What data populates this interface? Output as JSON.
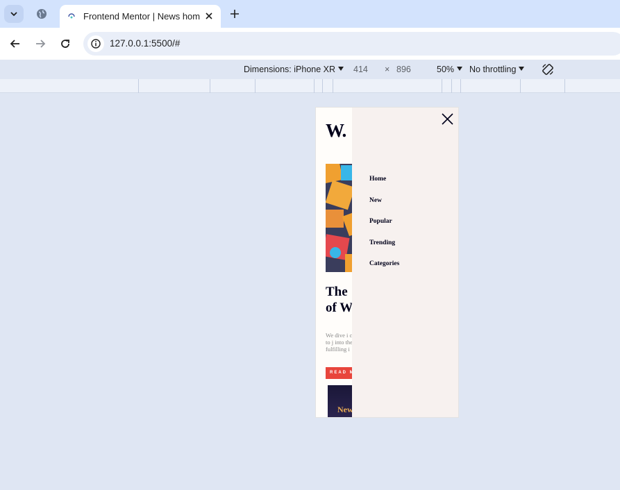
{
  "browser": {
    "active_tab_title": "Frontend Mentor | News homepage",
    "url": "127.0.0.1:5500/#"
  },
  "devtools": {
    "dimensions_label": "Dimensions: iPhone XR",
    "width": "414",
    "times": "×",
    "height": "896",
    "zoom": "50%",
    "throttling": "No throttling"
  },
  "page": {
    "logo": "W.",
    "headline_line1": "The",
    "headline_line2": "of W",
    "lead_text": "We dive i claims to j into the h fulfilling i",
    "read_more": "READ MORE",
    "new_title": "New",
    "menu": {
      "items": [
        {
          "label": "Home"
        },
        {
          "label": "New"
        },
        {
          "label": "Popular"
        },
        {
          "label": "Trending"
        },
        {
          "label": "Categories"
        }
      ]
    }
  },
  "colors": {
    "accent_red": "#e8453c",
    "menu_bg": "#f7f1ef",
    "dark_navy": "#00001a",
    "gold": "#e9ab53",
    "chrome_blue": "#d3e3fd"
  }
}
